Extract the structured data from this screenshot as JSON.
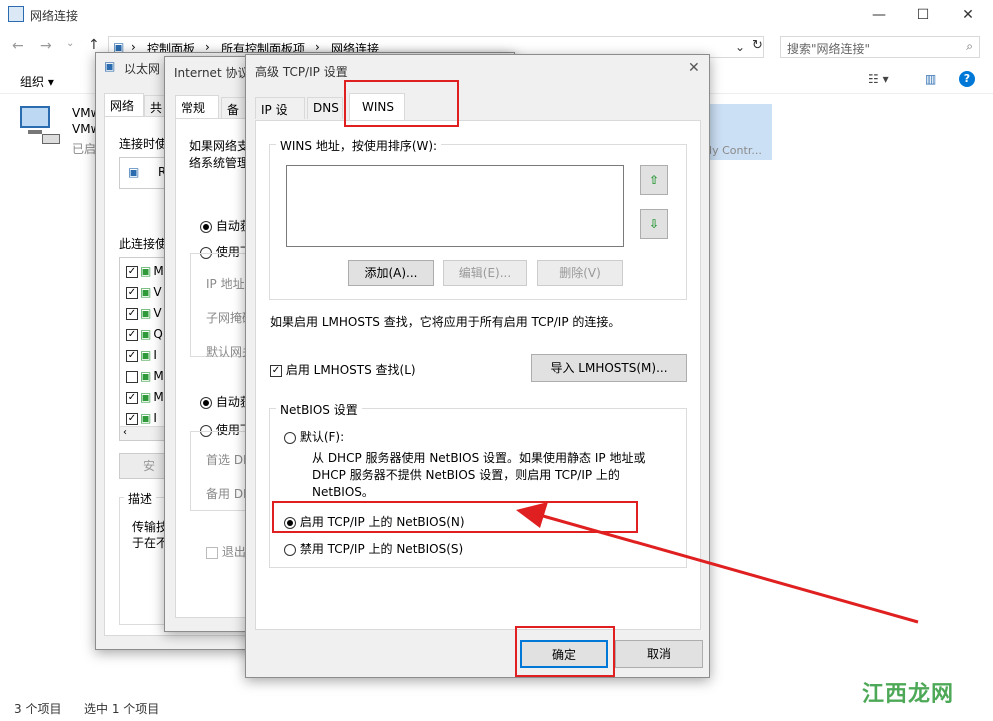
{
  "explorer": {
    "title": "网络连接",
    "breadcrumb": [
      "控制面板",
      "所有控制面板项",
      "网络连接"
    ],
    "search_placeholder": "搜索\"网络连接\"",
    "organize": "组织",
    "adapter": {
      "line1": "VMw",
      "line2": "VMw",
      "line3": "已启"
    },
    "other_adapter": "ily Contr...",
    "status_items": "3 个项目",
    "status_selected": "选中 1 个项目"
  },
  "ethernet": {
    "title": "以太网",
    "tabs": [
      "网络",
      "共"
    ],
    "connect_using": "连接时使",
    "adapter_prefix": "R",
    "items_label": "此连接使",
    "items": [
      {
        "checked": true,
        "label": "M"
      },
      {
        "checked": true,
        "label": "V"
      },
      {
        "checked": true,
        "label": "V"
      },
      {
        "checked": true,
        "label": "Q"
      },
      {
        "checked": true,
        "label": "I"
      },
      {
        "checked": false,
        "label": "M"
      },
      {
        "checked": true,
        "label": "M"
      },
      {
        "checked": true,
        "label": "I"
      }
    ],
    "install_button": "安",
    "desc_label": "描述",
    "desc_line1": "传输技",
    "desc_line2": "于在不"
  },
  "ipv4": {
    "title": "Internet 协议",
    "tabs": [
      "常规",
      "备用"
    ],
    "intro1": "如果网络支",
    "intro2": "络系统管理",
    "auto_ip": "自动获",
    "manual_ip": "使用下",
    "ip_addr": "IP 地址(",
    "subnet": "子网掩码",
    "gateway": "默认网关",
    "auto_dns": "自动获",
    "manual_dns": "使用下",
    "pref_dns": "首选 DN",
    "alt_dns": "备用 DN",
    "exit_validate": "退出时"
  },
  "advanced": {
    "title": "高级 TCP/IP 设置",
    "tabs": [
      "IP 设置",
      "DNS",
      "WINS"
    ],
    "wins_group": "WINS 地址，按使用排序(W):",
    "add": "添加(A)...",
    "edit": "编辑(E)...",
    "delete": "删除(V)",
    "lmhosts_note": "如果启用 LMHOSTS 查找，它将应用于所有启用 TCP/IP 的连接。",
    "lmhosts_check": "启用 LMHOSTS 查找(L)",
    "import_lmhosts": "导入 LMHOSTS(M)...",
    "netbios_group": "NetBIOS 设置",
    "default_opt": "默认(F):",
    "default_desc1": "从 DHCP 服务器使用 NetBIOS 设置。如果使用静态 IP 地址或",
    "default_desc2": "DHCP 服务器不提供 NetBIOS 设置，则启用 TCP/IP 上的",
    "default_desc3": "NetBIOS。",
    "enable_opt": "启用 TCP/IP 上的 NetBIOS(N)",
    "disable_opt": "禁用 TCP/IP 上的 NetBIOS(S)",
    "ok": "确定",
    "cancel": "取消"
  },
  "watermark": "江西龙网",
  "colors": {
    "annotation_red": "#e02020",
    "accent_blue": "#0078d7"
  }
}
